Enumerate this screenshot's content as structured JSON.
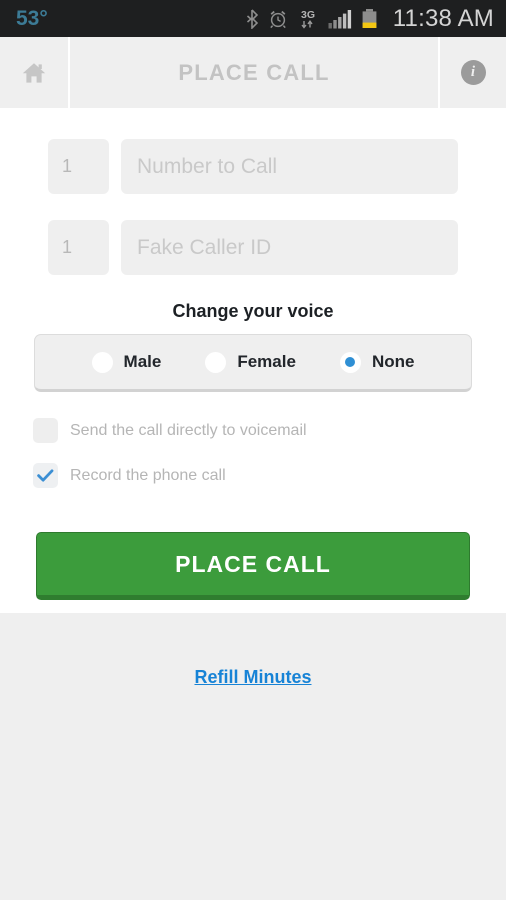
{
  "statusbar": {
    "temperature": "53°",
    "clock": "11:38 AM",
    "icons": [
      "bluetooth-icon",
      "alarm-clock-icon",
      "3g-data-icon",
      "signal-bars-icon",
      "battery-icon"
    ],
    "network_label": "3G",
    "background": "#1e1f20",
    "temp_color": "#3c7b96",
    "clock_color": "#d4d4d4",
    "battery_color": "#f3c613"
  },
  "header": {
    "home_icon": "home-icon",
    "title": "PLACE CALL",
    "info_icon_label": "i",
    "title_color": "#c3c3c3"
  },
  "form": {
    "number_to_call": {
      "country_code": "1",
      "value": "",
      "placeholder": "Number to Call"
    },
    "fake_caller_id": {
      "country_code": "1",
      "value": "",
      "placeholder": "Fake Caller ID"
    },
    "voice": {
      "title": "Change your voice",
      "options": [
        {
          "label": "Male",
          "selected": false
        },
        {
          "label": "Female",
          "selected": false
        },
        {
          "label": "None",
          "selected": true
        }
      ],
      "selected_value": "None",
      "accent_color": "#2f8fd4"
    },
    "checkboxes": [
      {
        "label": "Send the call directly to voicemail",
        "checked": false
      },
      {
        "label": "Record the phone call",
        "checked": true
      }
    ],
    "submit_label": "PLACE CALL",
    "submit_color": "#3c9c3c"
  },
  "footer": {
    "refill_link": "Refill Minutes",
    "link_color": "#1783d6"
  }
}
